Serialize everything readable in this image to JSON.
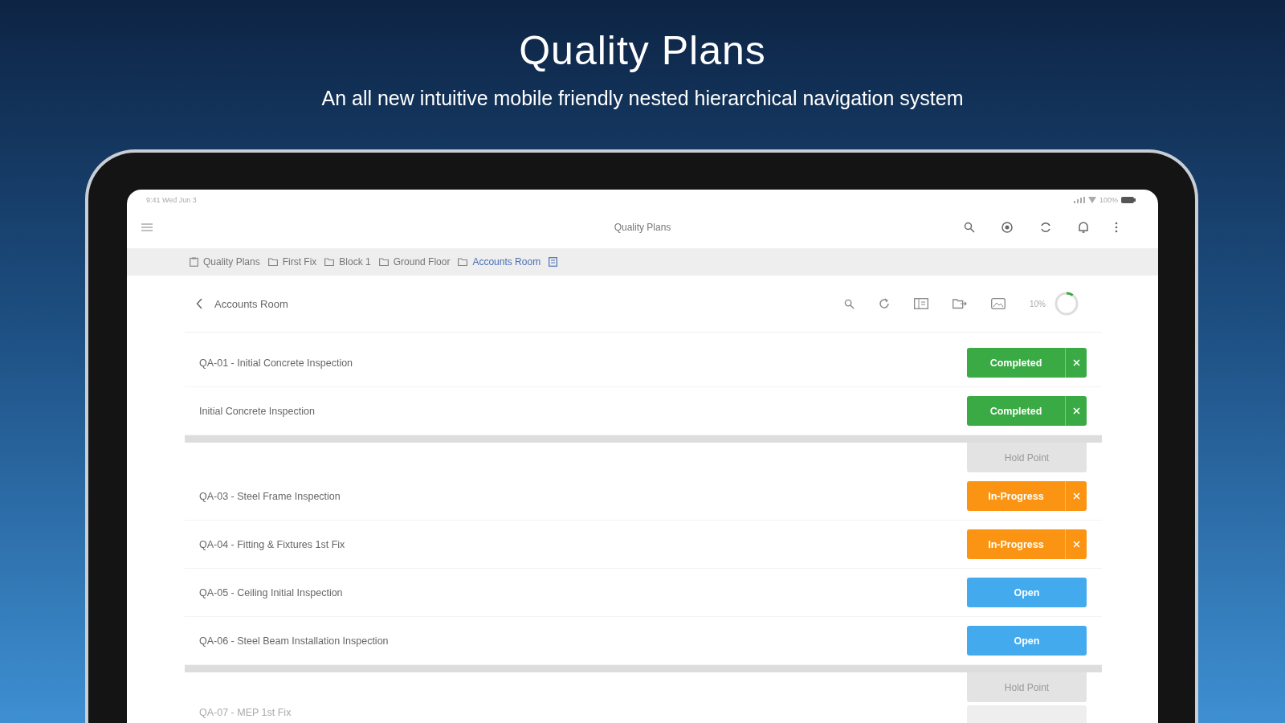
{
  "headline": "Quality Plans",
  "subheadline": "An all new intuitive mobile friendly nested hierarchical navigation system",
  "status_bar": {
    "time": "9:41 Wed Jun 3",
    "battery": "100%"
  },
  "app_bar": {
    "title": "Quality Plans"
  },
  "breadcrumbs": [
    {
      "label": "Quality Plans",
      "kind": "root",
      "selected": false
    },
    {
      "label": "First Fix",
      "kind": "folder",
      "selected": false
    },
    {
      "label": "Block 1",
      "kind": "folder",
      "selected": false
    },
    {
      "label": "Ground Floor",
      "kind": "folder",
      "selected": false
    },
    {
      "label": "Accounts Room",
      "kind": "folder",
      "selected": true
    }
  ],
  "header": {
    "title": "Accounts Room",
    "progress_text": "10%",
    "level": 0.1
  },
  "rows": [
    {
      "kind": "item",
      "text": "QA-01 - Initial Concrete Inspection",
      "color": "#3aaa44",
      "label": "Completed",
      "removable": true
    },
    {
      "kind": "item",
      "text": "Initial Concrete Inspection",
      "color": "#3aaa44",
      "label": "Completed",
      "removable": true
    },
    {
      "kind": "hold_point",
      "label": "Hold Point"
    },
    {
      "kind": "item",
      "text": "QA-03 - Steel Frame Inspection",
      "color": "#fb9412",
      "label": "In-Progress",
      "removable": true
    },
    {
      "kind": "item",
      "text": "QA-04 - Fitting & Fixtures 1st Fix",
      "color": "#fb9412",
      "label": "In-Progress",
      "removable": true
    },
    {
      "kind": "item",
      "text": "QA-05 - Ceiling Initial Inspection",
      "color": "#44aaee",
      "label": "Open",
      "removable": false
    },
    {
      "kind": "item",
      "text": "QA-06 - Steel Beam Installation Inspection",
      "color": "#44aaee",
      "label": "Open",
      "removable": false
    },
    {
      "kind": "hold_point",
      "label": "Hold Point"
    },
    {
      "kind": "item",
      "text": "QA-07 - MEP 1st Fix",
      "color": "#eeeeee",
      "removable": false
    }
  ]
}
